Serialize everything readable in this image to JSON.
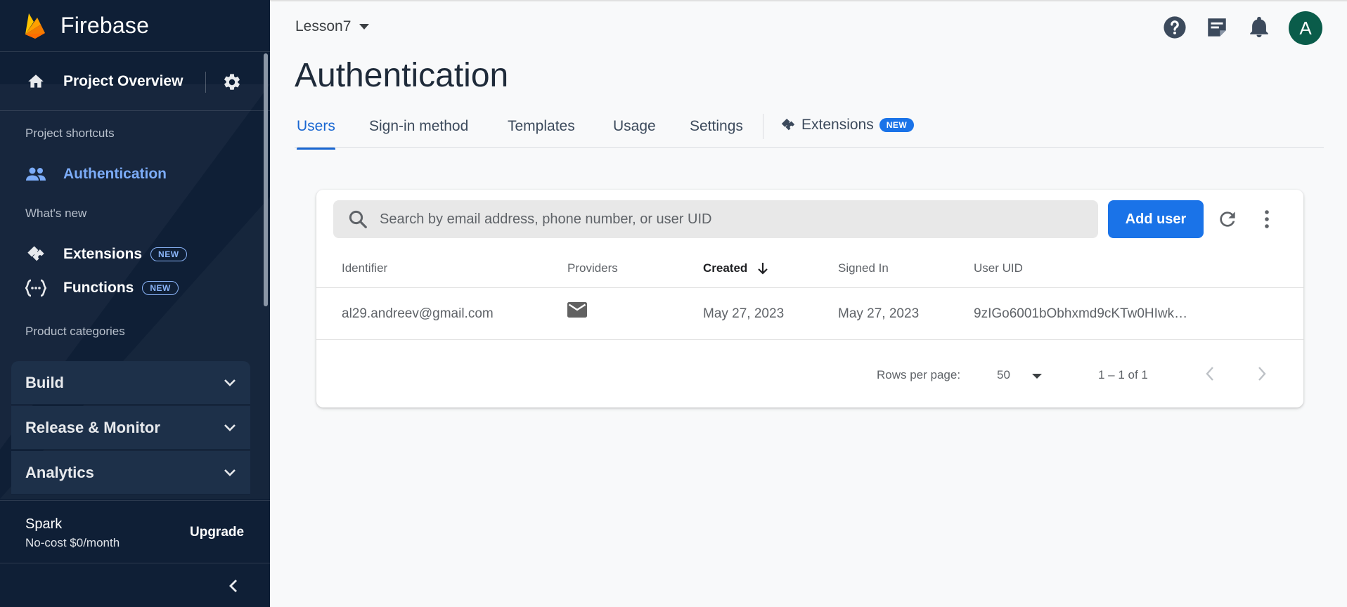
{
  "sidebar": {
    "brand": "Firebase",
    "overview_label": "Project Overview",
    "section_shortcuts": "Project shortcuts",
    "shortcut_item": "Authentication",
    "section_whats_new": "What's new",
    "new_items": [
      {
        "label": "Extensions",
        "badge": "NEW"
      },
      {
        "label": "Functions",
        "badge": "NEW"
      }
    ],
    "section_categories": "Product categories",
    "categories": [
      "Build",
      "Release & Monitor",
      "Analytics"
    ],
    "plan_name": "Spark",
    "plan_cost": "No-cost $0/month",
    "upgrade_label": "Upgrade"
  },
  "topbar": {
    "project": "Lesson7",
    "avatar_letter": "A"
  },
  "page": {
    "title": "Authentication",
    "tabs": [
      "Users",
      "Sign-in method",
      "Templates",
      "Usage",
      "Settings"
    ],
    "active_tab": "Users",
    "extensions_tab": {
      "label": "Extensions",
      "badge": "NEW"
    }
  },
  "users": {
    "search_placeholder": "Search by email address, phone number, or user UID",
    "add_user_label": "Add user",
    "columns": [
      "Identifier",
      "Providers",
      "Created",
      "Signed In",
      "User UID"
    ],
    "sorted_column": "Created",
    "rows": [
      {
        "identifier": "al29.andreev@gmail.com",
        "provider_icon": "email-icon",
        "created": "May 27, 2023",
        "signed_in": "May 27, 2023",
        "uid": "9zIGo6001bObhxmd9cKTw0HIwk…"
      }
    ],
    "rows_per_page_label": "Rows per page:",
    "rows_per_page": "50",
    "range": "1 – 1 of 1"
  },
  "colors": {
    "sidebar_bg": "#0f1f36",
    "accent": "#1a73e8",
    "active_sidebar": "#7cacf8",
    "avatar_bg": "#0a5c4a"
  }
}
